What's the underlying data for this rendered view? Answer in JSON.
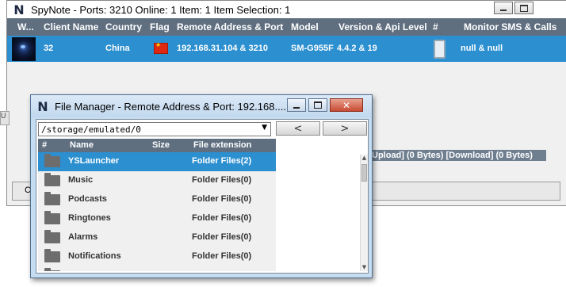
{
  "main_window": {
    "title": "SpyNote - Ports: 3210 Online: 1 Item: 1 Item Selection: 1",
    "columns": [
      "W...",
      "Client Name",
      "Country",
      "Flag",
      "Remote Address & Port",
      "Model",
      "Version & Api Level",
      "#",
      "Monitor SMS & Calls"
    ],
    "row": {
      "client_name": "32",
      "country": "China",
      "remote_address": "192.168.31.104 & 3210",
      "model": "SM-G955F",
      "version": "4.4.2 & 19",
      "monitor": "null & null"
    },
    "status": "Upload] (0 Bytes) [Download] (0 Bytes)",
    "bottom_label": "C",
    "left_stub": "U"
  },
  "file_manager": {
    "title": "File Manager - Remote Address & Port: 192.168....",
    "path": "/storage/emulated/0",
    "back_label": "<",
    "forward_label": ">",
    "columns": {
      "index": "#",
      "name": "Name",
      "size": "Size",
      "extension": "File extension"
    },
    "rows": [
      {
        "name": "YSLauncher",
        "ext": "Folder Files(2)"
      },
      {
        "name": "Music",
        "ext": "Folder Files(0)"
      },
      {
        "name": "Podcasts",
        "ext": "Folder Files(0)"
      },
      {
        "name": "Ringtones",
        "ext": "Folder Files(0)"
      },
      {
        "name": "Alarms",
        "ext": "Folder Files(0)"
      },
      {
        "name": "Notifications",
        "ext": "Folder Files(0)"
      }
    ]
  },
  "colors": {
    "header_bg": "#5f6f80",
    "selection_bg": "#2b8fd0"
  }
}
